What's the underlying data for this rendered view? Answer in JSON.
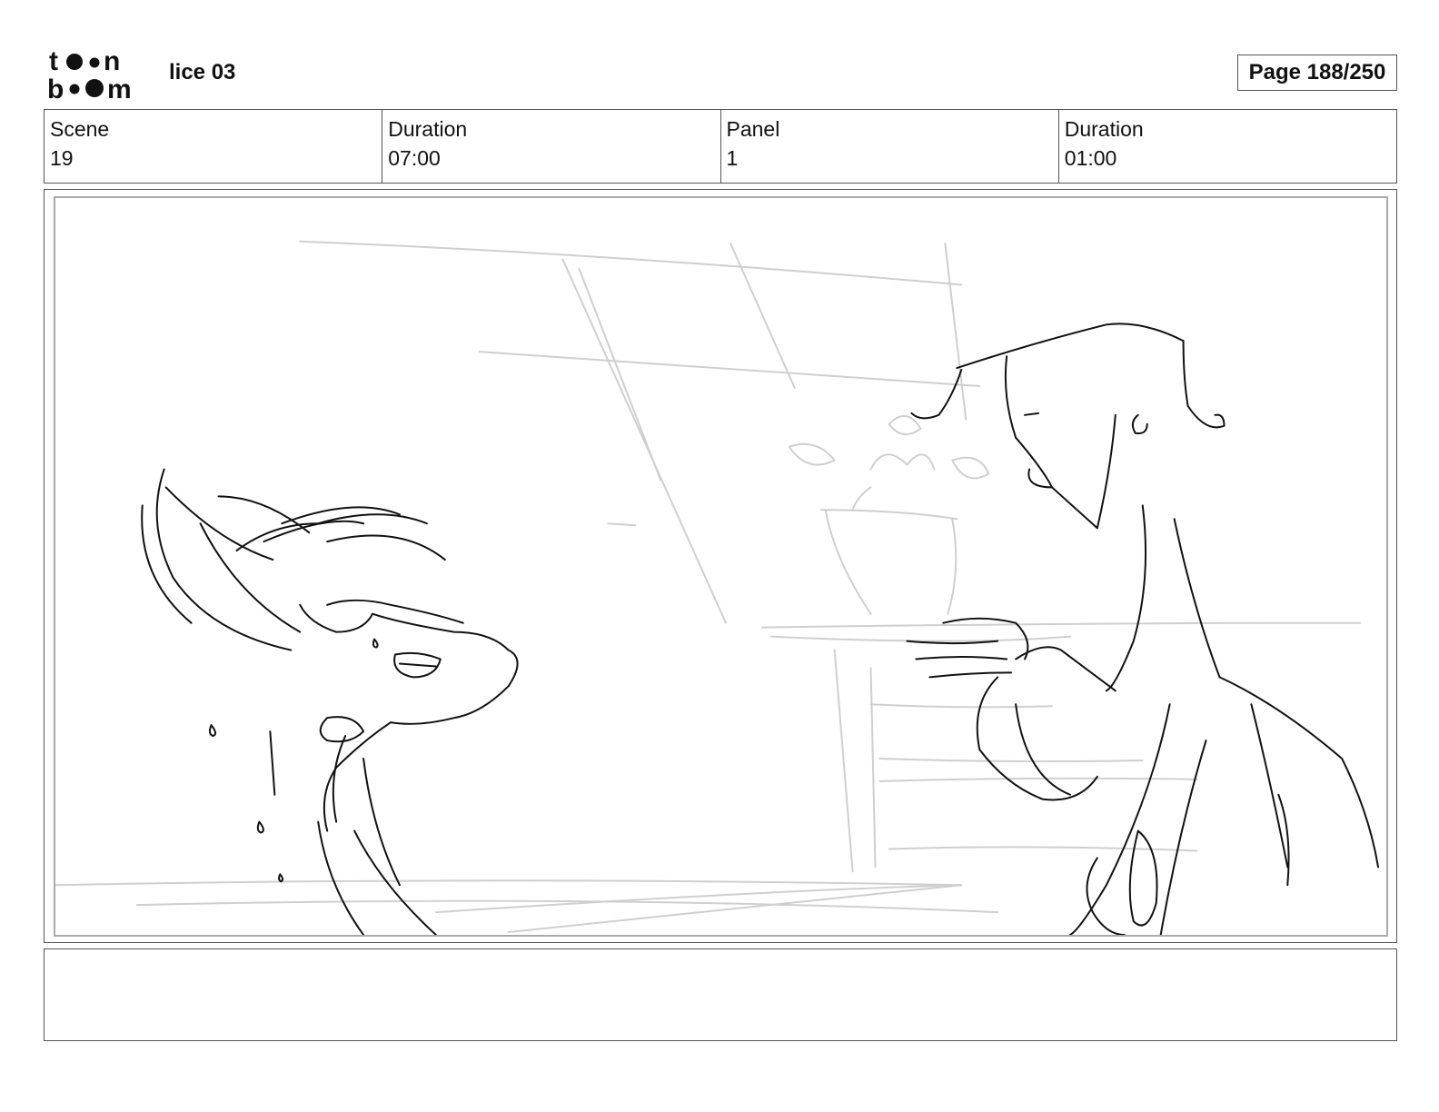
{
  "header": {
    "logo": {
      "name": "toon boom logo",
      "text_line1": "toon",
      "text_line2": "boom"
    },
    "project_title": "lice 03",
    "page_indicator": "Page 188/250"
  },
  "info": [
    {
      "label": "Scene",
      "value": "19"
    },
    {
      "label": "Duration",
      "value": "07:00"
    },
    {
      "label": "Panel",
      "value": "1"
    },
    {
      "label": "Duration",
      "value": "01:00"
    }
  ],
  "panel": {
    "description": ""
  },
  "notes": {
    "text": ""
  }
}
